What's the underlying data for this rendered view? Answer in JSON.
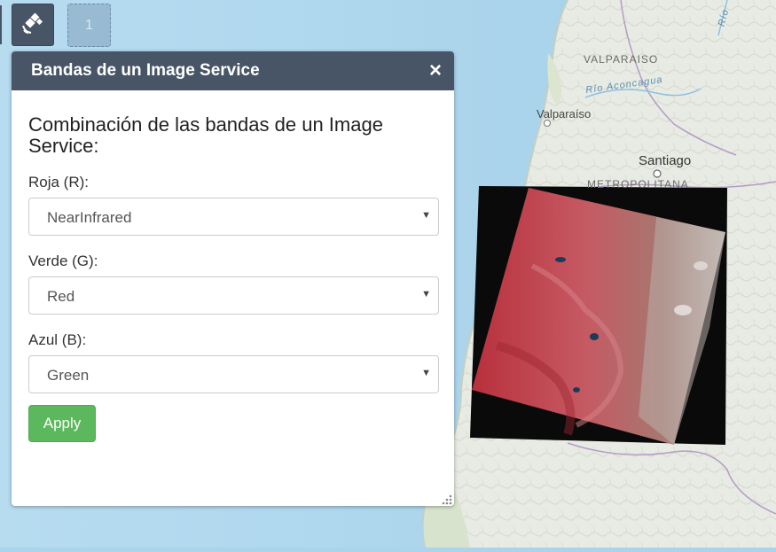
{
  "map": {
    "labels": {
      "region_valparaiso": "VALPARAISO",
      "river": "Río Aconcagua",
      "city_valparaiso": "Valparaíso",
      "city_santiago": "Santiago",
      "region_metropolitana": "METROPOLITANA",
      "river_top": "Río"
    },
    "colors": {
      "ocean": "#aad3ec",
      "land": "#e9ece2",
      "raster": "#c0545f"
    }
  },
  "toolbar": {
    "widget_icon": "satellite-icon",
    "placeholder_label": "1"
  },
  "panel": {
    "title": "Bandas de un Image Service",
    "close_label": "×",
    "heading": "Combinación de las bandas de un Image Service:",
    "fields": [
      {
        "label": "Roja (R):",
        "value": "NearInfrared"
      },
      {
        "label": "Verde (G):",
        "value": "Red"
      },
      {
        "label": "Azul (B):",
        "value": "Green"
      }
    ],
    "apply_label": "Apply",
    "colors": {
      "header": "#485566",
      "apply": "#5cb85c"
    }
  }
}
